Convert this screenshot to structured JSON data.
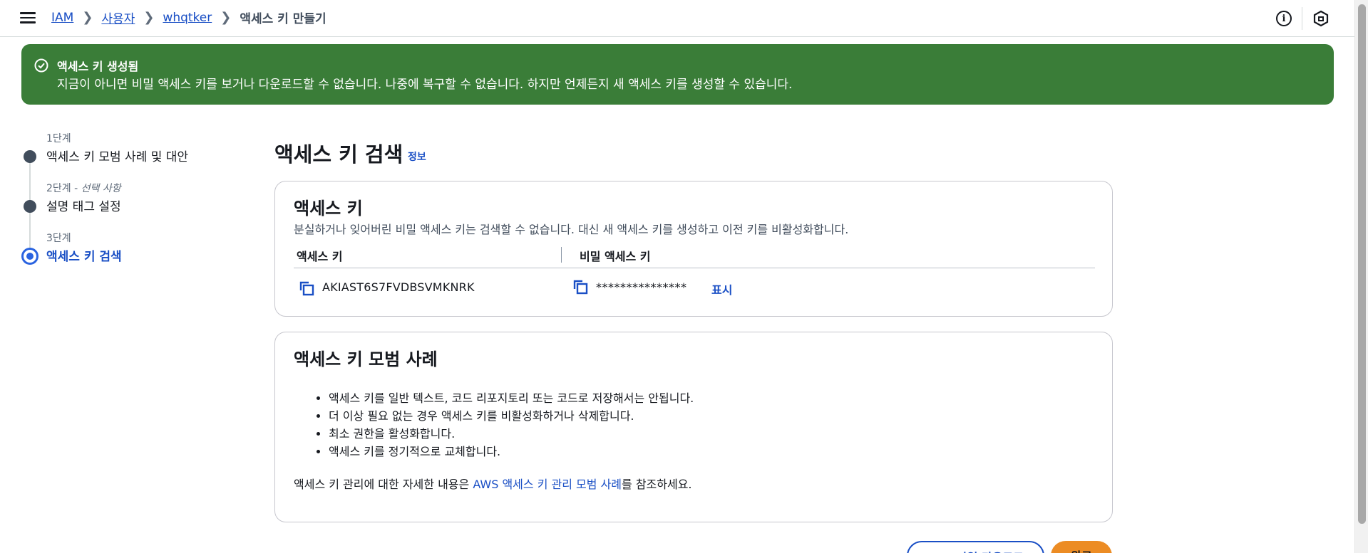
{
  "breadcrumb": {
    "items": [
      "IAM",
      "사용자",
      "whqtker"
    ],
    "current": "액세스 키 만들기"
  },
  "flash": {
    "title": "액세스 키 생성됨",
    "message": "지금이 아니면 비밀 액세스 키를 보거나 다운로드할 수 없습니다. 나중에 복구할 수 없습니다. 하지만 언제든지 새 액세스 키를 생성할 수 있습니다."
  },
  "steps": [
    {
      "number": "1단계",
      "optional": "",
      "label": "액세스 키 모범 사례 및 대안"
    },
    {
      "number": "2단계",
      "optional": "선택 사항",
      "label": "설명 태그 설정"
    },
    {
      "number": "3단계",
      "optional": "",
      "label": "액세스 키 검색"
    }
  ],
  "main": {
    "title": "액세스 키 검색",
    "info_link": "정보"
  },
  "access_key_card": {
    "title": "액세스 키",
    "description": "분실하거나 잊어버린 비밀 액세스 키는 검색할 수 없습니다. 대신 새 액세스 키를 생성하고 이전 키를 비활성화합니다.",
    "col_access_key": "액세스 키",
    "col_secret_key": "비밀 액세스 키",
    "access_key_value": "AKIAST6S7FVDBSVMKNRK",
    "secret_key_masked": "***************",
    "show_label": "표시"
  },
  "best_practices_card": {
    "title": "액세스 키 모범 사례",
    "items": [
      "액세스 키를 일반 텍스트, 코드 리포지토리 또는 코드로 저장해서는 안됩니다.",
      "더 이상 필요 없는 경우 액세스 키를 비활성화하거나 삭제합니다.",
      "최소 권한을 활성화합니다.",
      "액세스 키를 정기적으로 교체합니다."
    ],
    "footer_prefix": "액세스 키 관리에 대한 자세한 내용은 ",
    "footer_link": "AWS 액세스 키 관리 모범 사례",
    "footer_suffix": "를 참조하세요."
  },
  "buttons": {
    "csv_download": ".csv 파일 다운로드",
    "done": "완료"
  },
  "colors": {
    "success_banner": "#3a7d38",
    "link": "#1a4fc5",
    "primary_button": "#ec8c24"
  }
}
